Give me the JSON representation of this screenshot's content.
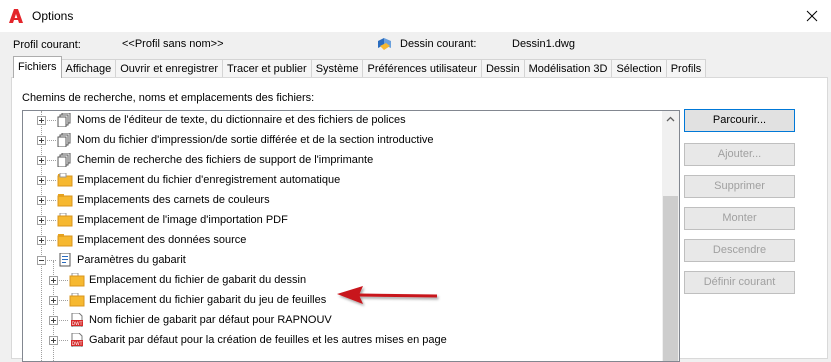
{
  "window": {
    "title": "Options",
    "close_glyph": "✕"
  },
  "profile": {
    "label": "Profil courant:",
    "value": "<<Profil sans nom>>",
    "drawing_label": "Dessin courant:",
    "drawing_value": "Dessin1.dwg"
  },
  "tabs": [
    {
      "label": "Fichiers",
      "active": true
    },
    {
      "label": "Affichage"
    },
    {
      "label": "Ouvrir et enregistrer"
    },
    {
      "label": "Tracer et publier"
    },
    {
      "label": "Système"
    },
    {
      "label": "Préférences utilisateur"
    },
    {
      "label": "Dessin"
    },
    {
      "label": "Modélisation 3D"
    },
    {
      "label": "Sélection"
    },
    {
      "label": "Profils"
    }
  ],
  "panel": {
    "section_label": "Chemins de recherche, noms et emplacements des fichiers:"
  },
  "tree": {
    "items": [
      {
        "label": "Noms de l'éditeur de texte, du dictionnaire et des fichiers de polices",
        "icon": "multi-document-icon"
      },
      {
        "label": "Nom du fichier d'impression/de sortie différée et de la section introductive",
        "icon": "multi-document-icon"
      },
      {
        "label": "Chemin de recherche des fichiers de support de l'imprimante",
        "icon": "multi-document-icon"
      },
      {
        "label": "Emplacement du fichier d'enregistrement automatique",
        "icon": "folder-icon"
      },
      {
        "label": "Emplacements des carnets de couleurs",
        "icon": "folder-icon"
      },
      {
        "label": "Emplacement de l'image d'importation PDF",
        "icon": "folder-icon"
      },
      {
        "label": "Emplacement des données source",
        "icon": "folder-icon"
      },
      {
        "label": "Paramètres du gabarit",
        "icon": "template-settings-icon"
      },
      {
        "label": "Emplacement du fichier de gabarit du dessin",
        "icon": "folder-icon"
      },
      {
        "label": "Emplacement du fichier gabarit du jeu de feuilles",
        "icon": "folder-icon"
      },
      {
        "label": "Nom fichier de gabarit par défaut pour RAPNOUV",
        "icon": "dwt-file-icon"
      },
      {
        "label": "Gabarit par défaut pour la création de feuilles et les autres mises en page",
        "icon": "dwt-file-icon"
      }
    ],
    "dwt_badge": "DWT"
  },
  "buttons": {
    "browse": "Parcourir...",
    "add": "Ajouter...",
    "remove": "Supprimer",
    "move_up": "Monter",
    "move_down": "Descendre",
    "set_current": "Définir courant"
  },
  "colors": {
    "accent": "#0078d7",
    "arrow": "#c8161d",
    "folder": "#f6b830",
    "disabled_text": "#a0a0a0"
  }
}
